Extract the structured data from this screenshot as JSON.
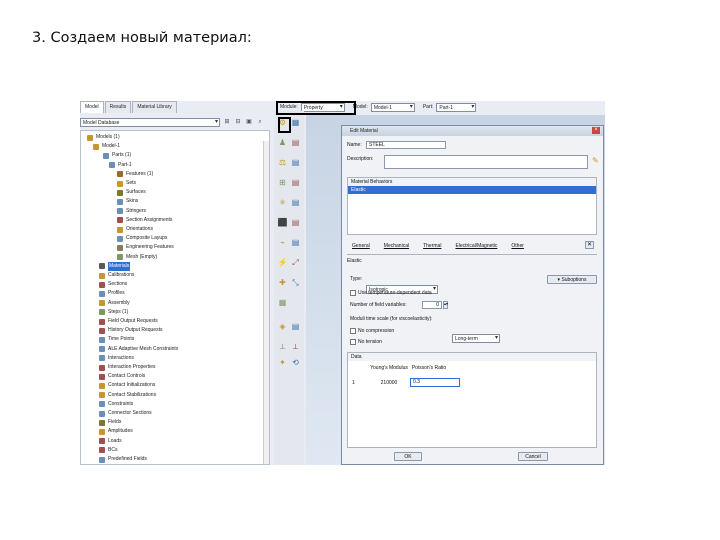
{
  "heading": "3. Создаем новый материал:",
  "tabs": [
    "Model",
    "Results",
    "Material Library"
  ],
  "tree_selector": "Model Database",
  "module_bar": {
    "module_label": "Module:",
    "module_value": "Property",
    "model_label": "Model:",
    "model_value": "Model-1",
    "part_label": "Part:",
    "part_value": "Part-1"
  },
  "tree": [
    {
      "label": "Models (1)"
    },
    {
      "label": "Model-1"
    },
    {
      "label": "Parts (1)"
    },
    {
      "label": "Part-1"
    },
    {
      "label": "Features (1)"
    },
    {
      "label": "Sets"
    },
    {
      "label": "Surfaces"
    },
    {
      "label": "Skins"
    },
    {
      "label": "Stringers"
    },
    {
      "label": "Section Assignments"
    },
    {
      "label": "Orientations"
    },
    {
      "label": "Composite Layups"
    },
    {
      "label": "Engineering Features"
    },
    {
      "label": "Mesh (Empty)"
    },
    {
      "label": "Materials"
    },
    {
      "label": "Calibrations"
    },
    {
      "label": "Sections"
    },
    {
      "label": "Profiles"
    },
    {
      "label": "Assembly"
    },
    {
      "label": "Steps (1)"
    },
    {
      "label": "Field Output Requests"
    },
    {
      "label": "History Output Requests"
    },
    {
      "label": "Time Points"
    },
    {
      "label": "ALE Adaptive Mesh Constraints"
    },
    {
      "label": "Interactions"
    },
    {
      "label": "Interaction Properties"
    },
    {
      "label": "Contact Controls"
    },
    {
      "label": "Contact Initializations"
    },
    {
      "label": "Contact Stabilizations"
    },
    {
      "label": "Constraints"
    },
    {
      "label": "Connector Sections"
    },
    {
      "label": "Fields"
    },
    {
      "label": "Amplitudes"
    },
    {
      "label": "Loads"
    },
    {
      "label": "BCs"
    },
    {
      "label": "Predefined Fields"
    }
  ],
  "dialog": {
    "title": "Edit Material",
    "name_label": "Name:",
    "name_value": "STEEL",
    "description_label": "Description:",
    "behaviors_label": "Material Behaviors",
    "behavior_item": "Elastic",
    "menu": [
      "General",
      "Mechanical",
      "Thermal",
      "Electrical/Magnetic",
      "Other"
    ],
    "section_title": "Elastic",
    "type_label": "Type:",
    "type_value": "Isotropic",
    "suboptions": "Suboptions",
    "temp_dep": "Use temperature-dependent data",
    "field_vars_label": "Number of field variables:",
    "field_vars_value": "0",
    "moduli_label": "Moduli time scale (for viscoelasticity):",
    "moduli_value": "Long-term",
    "no_compression": "No compression",
    "no_tension": "No tension",
    "data_label": "Data",
    "col1": "Young's Modulus",
    "col2": "Poisson's Ratio",
    "row_num": "1",
    "young": "210000",
    "poisson": "0.3",
    "ok": "OK",
    "cancel": "Cancel"
  },
  "colors": {
    "selection": "#2f6fd0",
    "accent": "#2f6fd0"
  }
}
